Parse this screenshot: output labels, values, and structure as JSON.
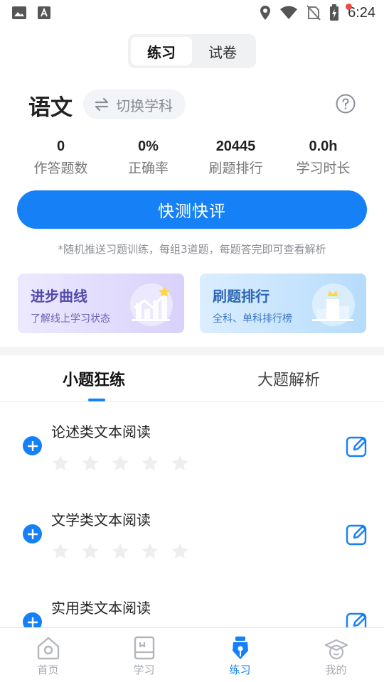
{
  "status_bar": {
    "time": "6:24",
    "icons": [
      "image-icon",
      "text-a-icon",
      "location-icon",
      "wifi-icon",
      "no-sim-icon",
      "battery-icon"
    ]
  },
  "segment": {
    "tabs": [
      {
        "label": "练习",
        "active": true
      },
      {
        "label": "试卷",
        "active": false
      }
    ]
  },
  "subject": {
    "name": "语文",
    "switch_label": "切换学科"
  },
  "stats": [
    {
      "value": "0",
      "label": "作答题数"
    },
    {
      "value": "0%",
      "label": "正确率"
    },
    {
      "value": "20445",
      "label": "刷题排行"
    },
    {
      "value": "0.0h",
      "label": "学习时长"
    }
  ],
  "main_button": {
    "label": "快测快评"
  },
  "hint": "*随机推送习题训练，每组3道题，每题答完即可查看解析",
  "cards": [
    {
      "title": "进步曲线",
      "subtitle": "了解线上学习状态"
    },
    {
      "title": "刷题排行",
      "subtitle": "全科、单科排行榜"
    }
  ],
  "tabs": [
    {
      "label": "小题狂练",
      "active": true
    },
    {
      "label": "大题解析",
      "active": false
    }
  ],
  "items": [
    {
      "title": "论述类文本阅读",
      "stars": 0,
      "max_stars": 5
    },
    {
      "title": "文学类文本阅读",
      "stars": 0,
      "max_stars": 5
    },
    {
      "title": "实用类文本阅读",
      "stars": 0,
      "max_stars": 5
    }
  ],
  "bottom_nav": [
    {
      "label": "首页",
      "icon": "home-icon",
      "active": false
    },
    {
      "label": "学习",
      "icon": "book-icon",
      "active": false
    },
    {
      "label": "练习",
      "icon": "pen-icon",
      "active": true
    },
    {
      "label": "我的",
      "icon": "profile-icon",
      "active": false
    }
  ],
  "colors": {
    "accent": "#1680f7",
    "star_empty": "#eeeeee",
    "notification_dot": "#f04848"
  }
}
